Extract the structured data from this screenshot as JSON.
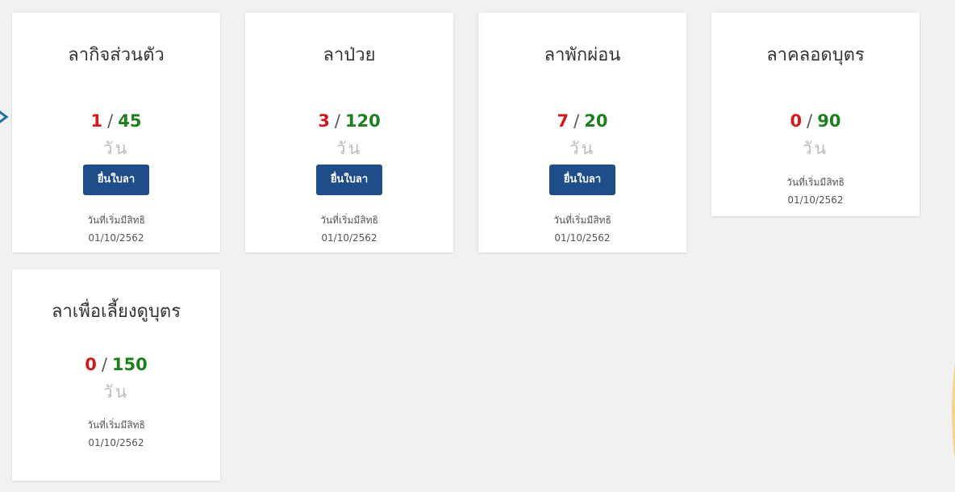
{
  "leave_cards": [
    {
      "title": "ลากิจส่วนตัว",
      "used": "1",
      "slash": "/",
      "total": "45",
      "unit": "วัน",
      "button_label": "ยื่นใบลา",
      "rights_label": "วันที่เริ่มมีสิทธิ",
      "rights_date": "01/10/2562"
    },
    {
      "title": "ลาป่วย",
      "used": "3",
      "slash": "/",
      "total": "120",
      "unit": "วัน",
      "button_label": "ยื่นใบลา",
      "rights_label": "วันที่เริ่มมีสิทธิ",
      "rights_date": "01/10/2562"
    },
    {
      "title": "ลาพักผ่อน",
      "used": "7",
      "slash": "/",
      "total": "20",
      "unit": "วัน",
      "button_label": "ยื่นใบลา",
      "rights_label": "วันที่เริ่มมีสิทธิ",
      "rights_date": "01/10/2562"
    },
    {
      "title": "ลาคลอดบุตร",
      "used": "0",
      "slash": "/",
      "total": "90",
      "unit": "วัน",
      "rights_label": "วันที่เริ่มมีสิทธิ",
      "rights_date": "01/10/2562"
    },
    {
      "title": "ลาเพื่อเลี้ยงดูบุตร",
      "used": "0",
      "slash": "/",
      "total": "150",
      "unit": "วัน",
      "rights_label": "วันที่เริ่มมีสิทธิ",
      "rights_date": "01/10/2562"
    }
  ],
  "colors": {
    "used": "#d3191c",
    "total": "#1d7f1d",
    "button": "#1f4d8a",
    "unit": "#bbbbbb",
    "background": "#f1f1f1"
  },
  "icons": {
    "left_edge": "chevron-right-icon",
    "right_edge": "decorative-arc-icon"
  }
}
